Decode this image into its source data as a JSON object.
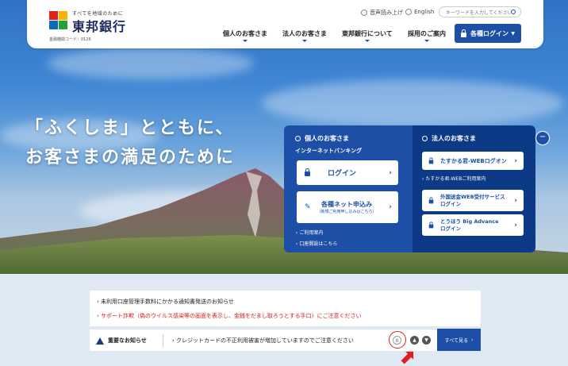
{
  "header": {
    "logo_tagline": "すべてを地域のために",
    "logo_name": "東邦銀行",
    "bank_code": "金融機関コード：0126",
    "voice_label": "音声読み上げ",
    "english_label": "English",
    "search_placeholder": "キーワードを入力してください",
    "nav": [
      "個人のお客さま",
      "法人のお客さま",
      "東邦銀行について",
      "採用のご案内"
    ],
    "login_label": "各種ログイン"
  },
  "hero": {
    "catch_line1": "「ふくしま」とともに、",
    "catch_line2": "お客さまの満足のために"
  },
  "personal_panel": {
    "title": "個人のお客さま",
    "subtitle": "インターネットバンキング",
    "login_label": "ログイン",
    "apply_label": "各種ネット申込み",
    "apply_sub": "（新規ご利用申し込みはこちら）",
    "link1": "ご利用案内",
    "link2": "口座開設はこちら"
  },
  "corporate_panel": {
    "title": "法人のお客さま",
    "web_login": "たすかる君-WEBログオン",
    "web_guide": "たすかる君-WEBご利用案内",
    "remit_line1": "外国送金WEB受付サービス",
    "remit_line2": "ログイン",
    "advance_line1": "とうほう Big Advance",
    "advance_line2": "ログイン"
  },
  "news": {
    "item1": "未利用口座管理手数料にかかる通知書発送のお知らせ",
    "item2": "サポート詐欺（偽のウイルス感染等の画面を表示し、金銭をだまし取ろうとする手口）にご注意ください"
  },
  "alert": {
    "label": "重要なお知らせ",
    "text": "クレジットカードの不正利用被害が増加していますのでご注意ください",
    "pause": "II",
    "see_all": "すべて見る"
  },
  "colors": {
    "primary": "#1c4fa5",
    "dark": "#0c3a86",
    "warning": "#d81d1d"
  }
}
